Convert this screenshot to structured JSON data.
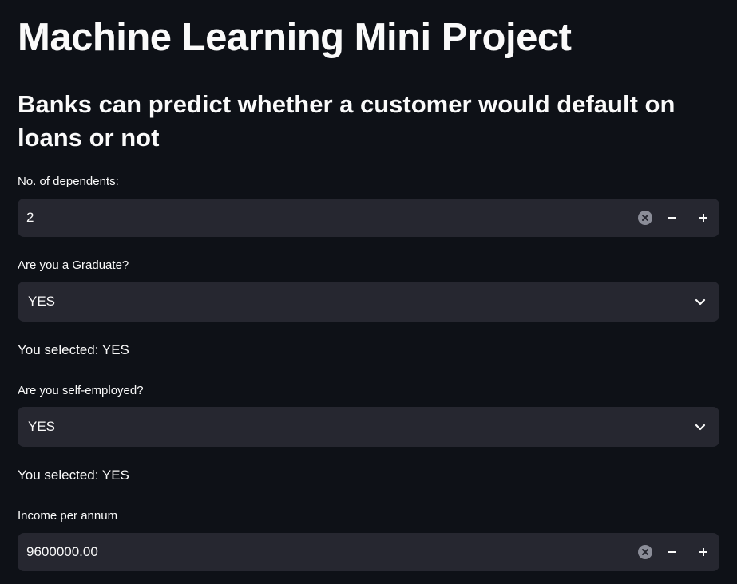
{
  "page": {
    "title": "Machine Learning Mini Project",
    "subtitle": "Banks can predict whether a customer would default on loans or not"
  },
  "form": {
    "dependents": {
      "label": "No. of dependents:",
      "value": "2"
    },
    "graduate": {
      "label": "Are you a Graduate?",
      "value": "YES",
      "selected_text": "You selected: YES"
    },
    "self_employed": {
      "label": "Are you self-employed?",
      "value": "YES",
      "selected_text": "You selected: YES"
    },
    "income": {
      "label": "Income per annum",
      "value": "9600000.00"
    }
  },
  "icons": {
    "clear": "clear-icon",
    "minus": "minus-icon",
    "plus": "plus-icon",
    "chevron": "chevron-down-icon"
  },
  "colors": {
    "background": "#0e1117",
    "input_background": "#262730",
    "text": "#fafafa",
    "clear_icon": "#8b8d98"
  }
}
